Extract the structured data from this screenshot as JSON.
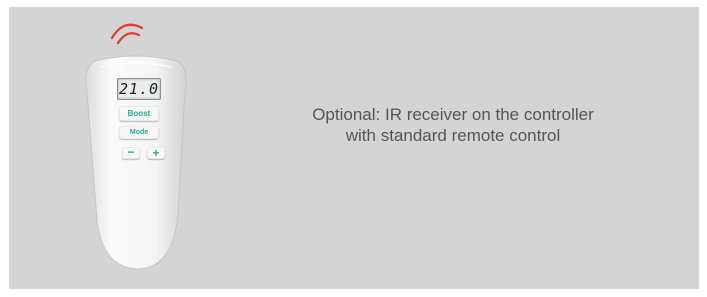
{
  "remote": {
    "display": "21.0",
    "buttons": {
      "boost": "Boost",
      "mode": "Mode",
      "minus": "−",
      "plus": "+"
    }
  },
  "caption": {
    "line1": "Optional: IR receiver on the controller",
    "line2": "with standard remote control"
  },
  "colors": {
    "background": "#d4d4d5",
    "ir_signal": "#e23b2e",
    "button_text": "#2ea58f",
    "caption_text": "#555555"
  }
}
